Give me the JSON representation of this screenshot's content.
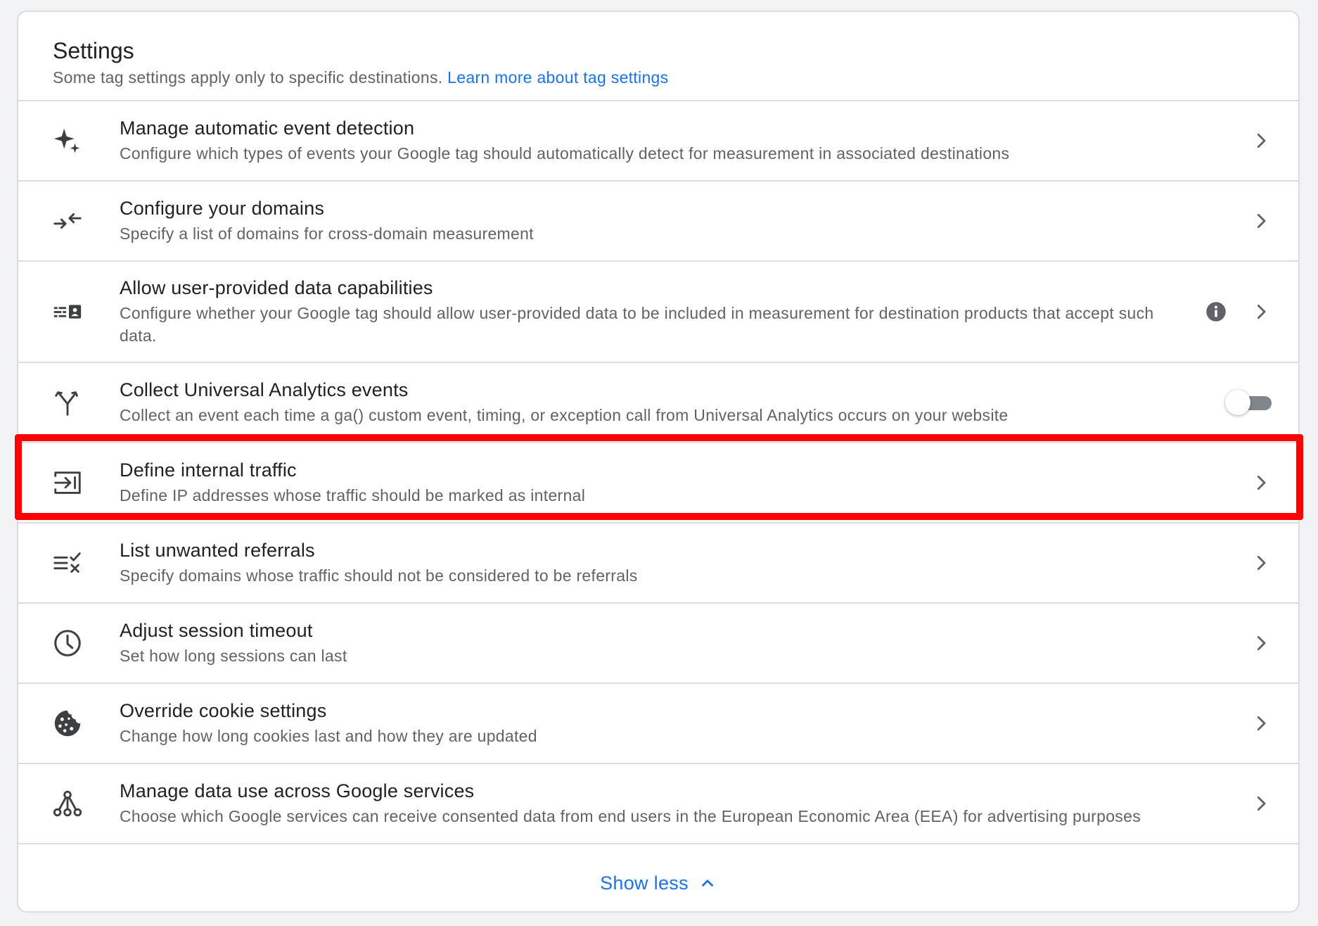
{
  "header": {
    "title": "Settings",
    "subtitle": "Some tag settings apply only to specific destinations.",
    "link": "Learn more about tag settings"
  },
  "rows": [
    {
      "title": "Manage automatic event detection",
      "description": "Configure which types of events your Google tag should automatically detect for measurement in associated destinations",
      "icon": "sparkle-icon"
    },
    {
      "title": "Configure your domains",
      "description": "Specify a list of domains for cross-domain measurement",
      "icon": "arrows-inward-icon"
    },
    {
      "title": "Allow user-provided data capabilities",
      "description": "Configure whether your Google tag should allow user-provided data to be included in measurement for destination products that accept such data.",
      "icon": "user-data-icon"
    },
    {
      "title": "Collect Universal Analytics events",
      "description": "Collect an event each time a ga() custom event, timing, or exception call from Universal Analytics occurs on your website",
      "icon": "fork-arrows-icon",
      "toggle_on": false
    },
    {
      "title": "Define internal traffic",
      "description": "Define IP addresses whose traffic should be marked as internal",
      "icon": "login-arrow-icon"
    },
    {
      "title": "List unwanted referrals",
      "description": "Specify domains whose traffic should not be considered to be referrals",
      "icon": "list-check-x-icon"
    },
    {
      "title": "Adjust session timeout",
      "description": "Set how long sessions can last",
      "icon": "clock-icon"
    },
    {
      "title": "Override cookie settings",
      "description": "Change how long cookies last and how they are updated",
      "icon": "cookie-icon"
    },
    {
      "title": "Manage data use across Google services",
      "description": "Choose which Google services can receive consented data from end users in the European Economic Area (EEA) for advertising purposes",
      "icon": "network-nodes-icon"
    }
  ],
  "footer": {
    "show_less": "Show less"
  },
  "colors": {
    "accent": "#1a73e8",
    "highlight": "#ff0000",
    "icon": "#3c4043",
    "toggle_track": "#80868b"
  }
}
